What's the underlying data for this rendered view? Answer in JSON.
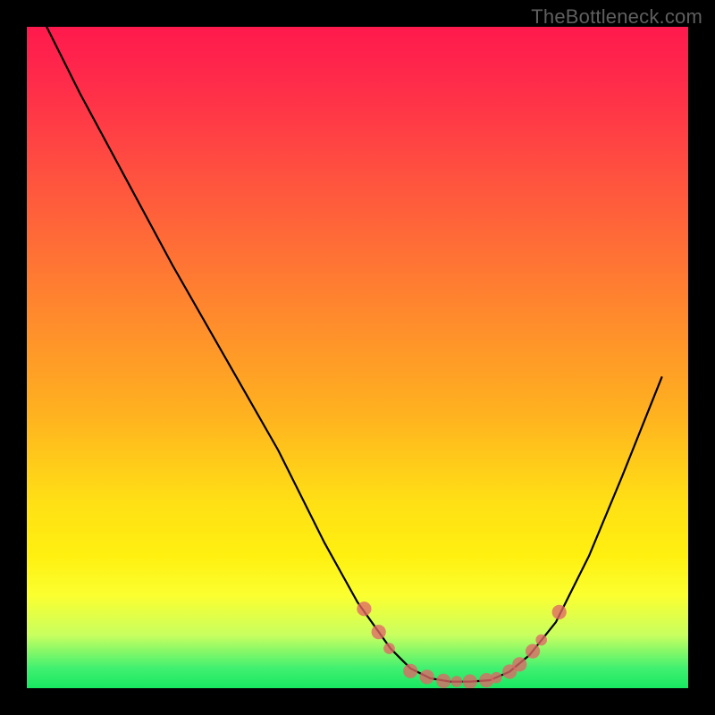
{
  "watermark": "TheBottleneck.com",
  "colors": {
    "background": "#000000",
    "gradient_top": "#ff1a4d",
    "gradient_bottom": "#18e860",
    "curve": "#000000",
    "dot_fill": "#e06666"
  },
  "chart_data": {
    "type": "line",
    "title": "",
    "xlabel": "",
    "ylabel": "",
    "xlim": [
      0,
      100
    ],
    "ylim": [
      0,
      100
    ],
    "series": [
      {
        "name": "bottleneck-curve",
        "x": [
          3,
          8,
          15,
          22,
          30,
          38,
          45,
          50,
          55,
          58,
          61,
          64,
          67,
          70,
          73,
          76,
          80,
          85,
          90,
          96
        ],
        "y": [
          100,
          90,
          77,
          64,
          50,
          36,
          22,
          13,
          6,
          3,
          1.5,
          1,
          1,
          1.2,
          2.5,
          5,
          10,
          20,
          32,
          47
        ]
      }
    ],
    "markers": [
      {
        "x": 51.0,
        "y": 12.0,
        "r": 1.1
      },
      {
        "x": 53.2,
        "y": 8.5,
        "r": 1.1
      },
      {
        "x": 54.8,
        "y": 6.0,
        "r": 0.85
      },
      {
        "x": 58.0,
        "y": 2.6,
        "r": 1.1
      },
      {
        "x": 60.5,
        "y": 1.7,
        "r": 1.1
      },
      {
        "x": 63.0,
        "y": 1.1,
        "r": 1.1
      },
      {
        "x": 65.0,
        "y": 1.0,
        "r": 0.85
      },
      {
        "x": 67.0,
        "y": 1.0,
        "r": 1.1
      },
      {
        "x": 69.5,
        "y": 1.2,
        "r": 1.1
      },
      {
        "x": 71.0,
        "y": 1.6,
        "r": 0.85
      },
      {
        "x": 73.0,
        "y": 2.5,
        "r": 1.1
      },
      {
        "x": 74.5,
        "y": 3.6,
        "r": 1.1
      },
      {
        "x": 76.5,
        "y": 5.6,
        "r": 1.1
      },
      {
        "x": 77.8,
        "y": 7.3,
        "r": 0.85
      },
      {
        "x": 80.5,
        "y": 11.5,
        "r": 1.1
      }
    ]
  }
}
